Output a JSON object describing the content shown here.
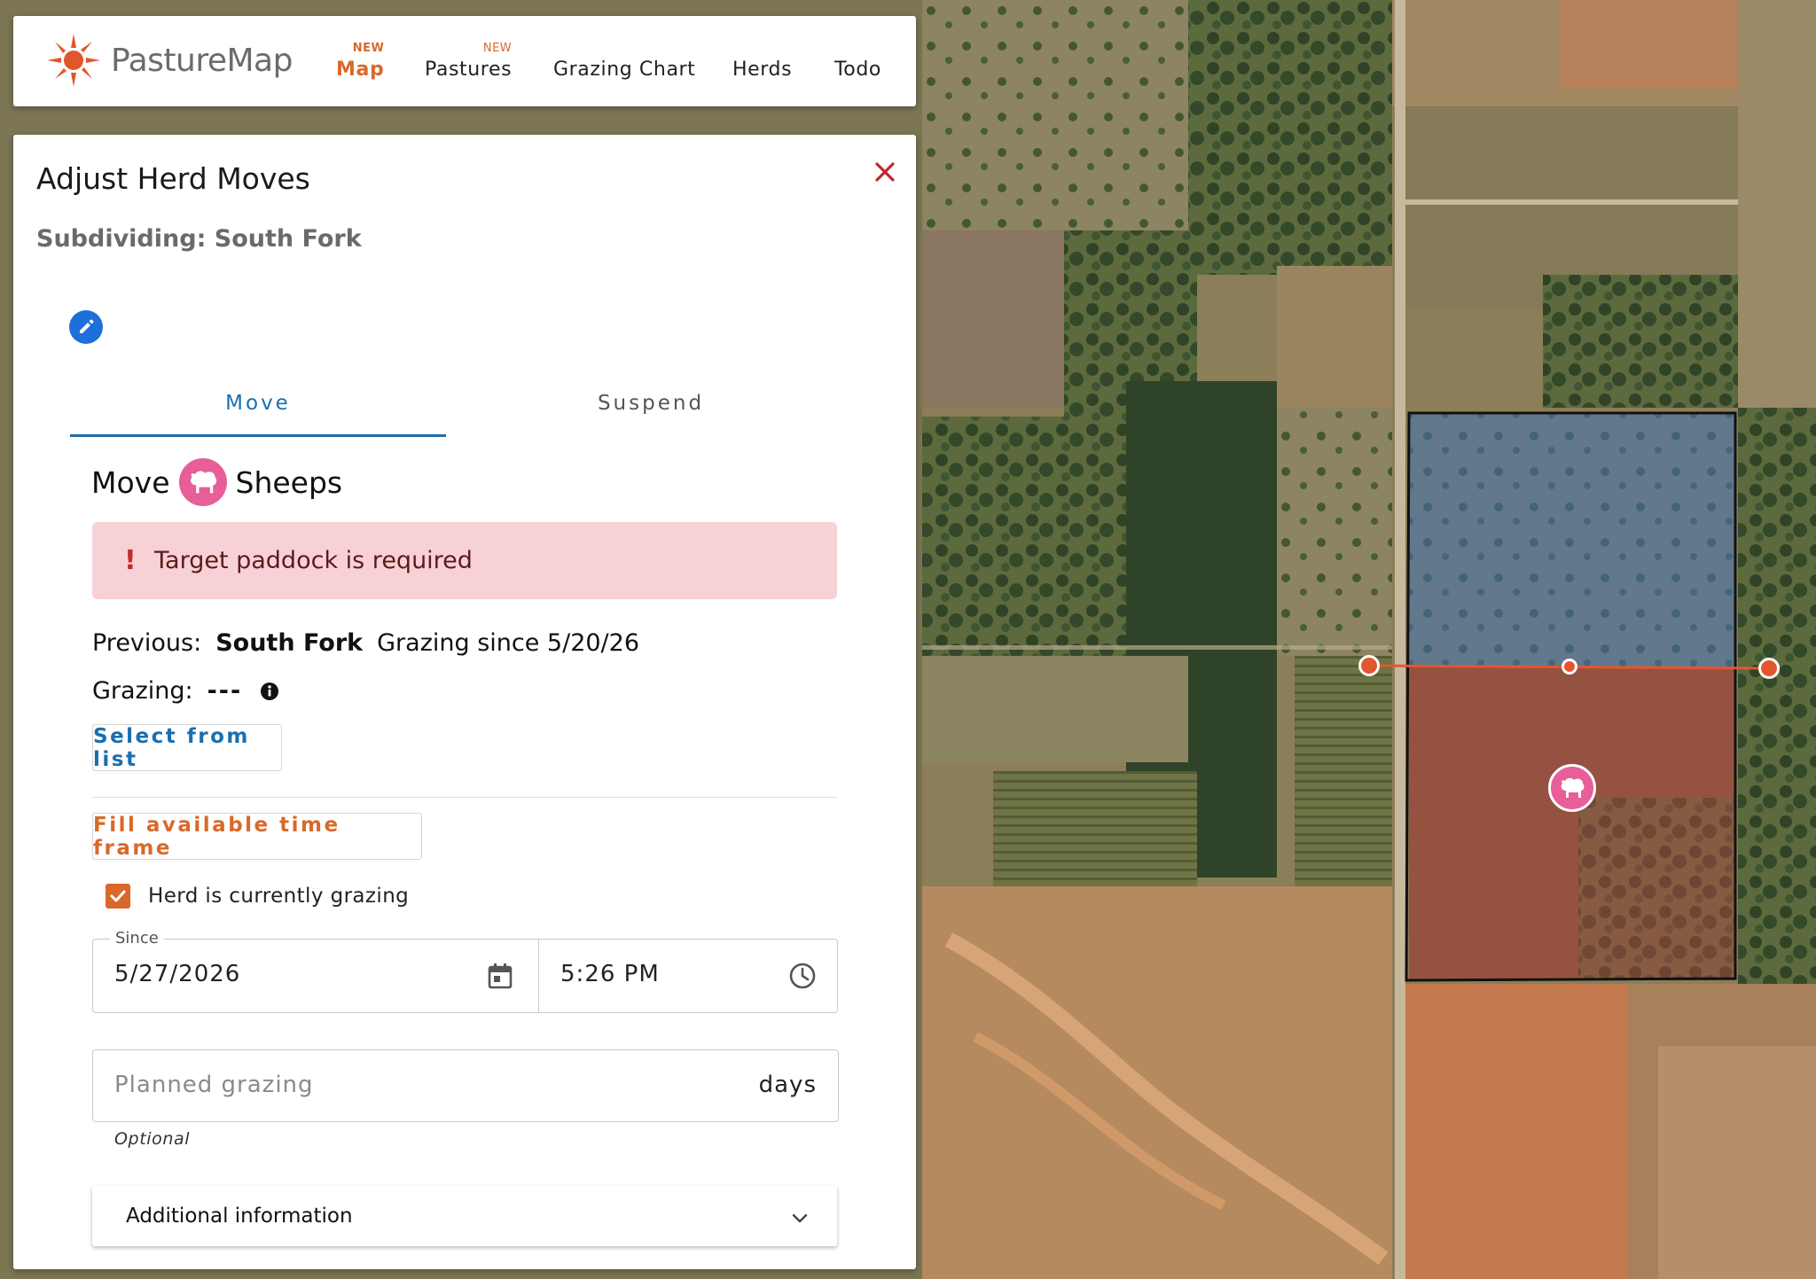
{
  "nav": {
    "logo_text": "PastureMap",
    "items": [
      {
        "label": "Map",
        "badge": "NEW",
        "active": true
      },
      {
        "label": "Pastures",
        "badge": "NEW",
        "active": false
      },
      {
        "label": "Grazing Chart",
        "badge": "",
        "active": false
      },
      {
        "label": "Herds",
        "badge": "",
        "active": false
      },
      {
        "label": "Todo",
        "badge": "",
        "active": false
      }
    ]
  },
  "panel": {
    "title": "Adjust Herd Moves",
    "subtitle": "Subdividing: South Fork",
    "tabs": [
      {
        "label": "Move",
        "active": true
      },
      {
        "label": "Suspend",
        "active": false
      }
    ],
    "move_heading": {
      "verb": "Move",
      "herd_name": "Sheeps",
      "herd_icon": "sheep-icon"
    },
    "alert": {
      "mark": "!",
      "text": "Target paddock is required"
    },
    "previous": {
      "label": "Previous:",
      "paddock": "South Fork",
      "since_text": "Grazing since 5/20/26"
    },
    "grazing": {
      "label": "Grazing:",
      "value": "---"
    },
    "select_button": "Select from list",
    "fill_button": "Fill available time frame",
    "currently_grazing": {
      "label": "Herd is currently grazing",
      "checked": true
    },
    "since": {
      "legend": "Since",
      "date": "5/27/2026",
      "time": "5:26 PM"
    },
    "planned": {
      "placeholder": "Planned grazing",
      "unit": "days",
      "helper": "Optional"
    },
    "additional_info": "Additional information"
  },
  "colors": {
    "accent_orange": "#d9692a",
    "accent_blue": "#1a6fae",
    "edit_blue": "#1d6fd9",
    "alert_bg": "#f8d1d6",
    "herd_pink": "#e85e98",
    "split_line": "#e4572e"
  }
}
